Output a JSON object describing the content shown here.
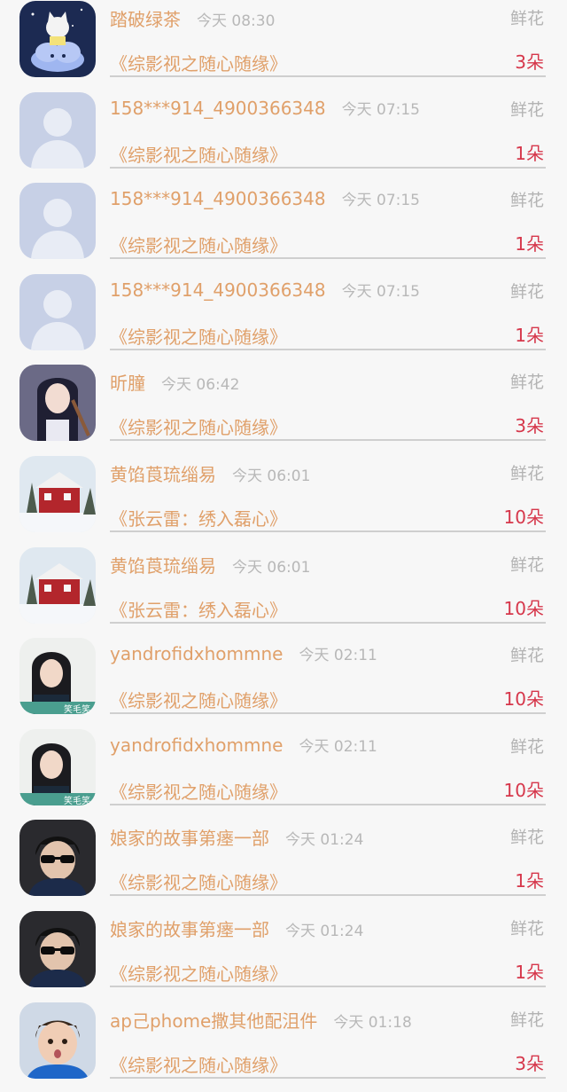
{
  "items": [
    {
      "user": "踏破绿茶",
      "time": "今天 08:30",
      "gift": "鲜花",
      "book": "《综影视之随心随缘》",
      "count": "3朵",
      "avatar": "cat-cloud"
    },
    {
      "user": "158***914_4900366348",
      "time": "今天 07:15",
      "gift": "鲜花",
      "book": "《综影视之随心随缘》",
      "count": "1朵",
      "avatar": "default"
    },
    {
      "user": "158***914_4900366348",
      "time": "今天 07:15",
      "gift": "鲜花",
      "book": "《综影视之随心随缘》",
      "count": "1朵",
      "avatar": "default"
    },
    {
      "user": "158***914_4900366348",
      "time": "今天 07:15",
      "gift": "鲜花",
      "book": "《综影视之随心随缘》",
      "count": "1朵",
      "avatar": "default"
    },
    {
      "user": "昕朣",
      "time": "今天 06:42",
      "gift": "鲜花",
      "book": "《综影视之随心随缘》",
      "count": "3朵",
      "avatar": "anime-girl"
    },
    {
      "user": "黄馅莨琉缁易",
      "time": "今天 06:01",
      "gift": "鲜花",
      "book": "《张云雷：绣入磊心》",
      "count": "10朵",
      "avatar": "snow-house"
    },
    {
      "user": "黄馅莨琉缁易",
      "time": "今天 06:01",
      "gift": "鲜花",
      "book": "《张云雷：绣入磊心》",
      "count": "10朵",
      "avatar": "snow-house"
    },
    {
      "user": "yandrofidxhommne",
      "time": "今天 02:11",
      "gift": "鲜花",
      "book": "《综影视之随心随缘》",
      "count": "10朵",
      "avatar": "girl-photo"
    },
    {
      "user": "yandrofidxhommne",
      "time": "今天 02:11",
      "gift": "鲜花",
      "book": "《综影视之随心随缘》",
      "count": "10朵",
      "avatar": "girl-photo"
    },
    {
      "user": "娘家的故事第瘗一部",
      "time": "今天 01:24",
      "gift": "鲜花",
      "book": "《综影视之随心随缘》",
      "count": "1朵",
      "avatar": "man-sunglasses"
    },
    {
      "user": "娘家的故事第瘗一部",
      "time": "今天 01:24",
      "gift": "鲜花",
      "book": "《综影视之随心随缘》",
      "count": "1朵",
      "avatar": "man-sunglasses"
    },
    {
      "user": "ap己phome撒其他配沮件",
      "time": "今天 01:18",
      "gift": "鲜花",
      "book": "《综影视之随心随缘》",
      "count": "3朵",
      "avatar": "kid-blue"
    }
  ],
  "avatar_watermark": "笑毛笑",
  "colors": {
    "name": "#e0a06a",
    "count": "#d6374b",
    "muted": "#b3b3b3",
    "divider": "#cfcfcf",
    "background": "#f7f7f7"
  }
}
